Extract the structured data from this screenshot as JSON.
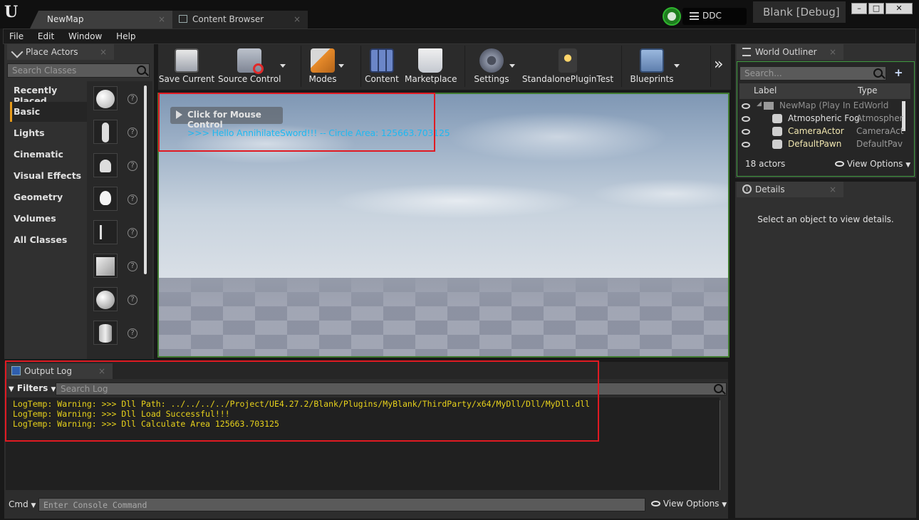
{
  "titlebar": {
    "tabs": [
      {
        "label": "NewMap",
        "close": "×"
      },
      {
        "label": "Content Browser",
        "close": "×"
      }
    ],
    "ddc_label": "DDC",
    "project_title": "Blank [Debug]",
    "window_controls": [
      "–",
      "□",
      "✕"
    ]
  },
  "menu": [
    "File",
    "Edit",
    "Window",
    "Help"
  ],
  "place_actors": {
    "tab_label": "Place Actors",
    "search_placeholder": "Search Classes",
    "categories": [
      "Recently Placed",
      "Basic",
      "Lights",
      "Cinematic",
      "Visual Effects",
      "Geometry",
      "Volumes",
      "All Classes"
    ],
    "selected_category": "Basic",
    "help_glyph": "?"
  },
  "toolbar": {
    "buttons": [
      "Save Current",
      "Source Control",
      "Modes",
      "Content",
      "Marketplace",
      "Settings",
      "StandalonePluginTest",
      "Blueprints"
    ],
    "overflow_glyph": "»"
  },
  "viewport": {
    "mouse_control_label": "Click for Mouse Control",
    "screen_message": ">>> Hello AnnihilateSword!!! -- Circle Area: 125663.703125"
  },
  "output_log": {
    "tab_label": "Output Log",
    "filters_label": "Filters",
    "search_placeholder": "Search Log",
    "lines": [
      "LogTemp: Warning: >>> Dll Path: ../../../../Project/UE4.27.2/Blank/Plugins/MyBlank/ThirdParty/x64/MyDll/Dll/MyDll.dll",
      "LogTemp: Warning: >>> Dll Load Successful!!!",
      "LogTemp: Warning: >>> Dll Calculate Area 125663.703125"
    ],
    "line_color": "#e8d21b",
    "cmd_label": "Cmd",
    "console_placeholder": "Enter Console Command",
    "view_options": "View Options"
  },
  "world_outliner": {
    "tab_label": "World Outliner",
    "search_placeholder": "Search...",
    "col_label": "Label",
    "col_type": "Type",
    "rows": [
      {
        "label": "NewMap (Play In EdWorld",
        "type": ""
      },
      {
        "label": "Atmospheric Fog",
        "type": "Atmospher"
      },
      {
        "label": "CameraActor",
        "type": "CameraAct"
      },
      {
        "label": "DefaultPawn",
        "type": "DefaultPav"
      }
    ],
    "actor_count": "18 actors",
    "view_options": "View Options"
  },
  "details": {
    "tab_label": "Details",
    "empty_message": "Select an object to view details."
  },
  "colors": {
    "accent": "#e59a1a",
    "highlight_box": "#e01a22",
    "screen_message": "#1fb8f0",
    "selected_actor": "#f0e6b0"
  }
}
